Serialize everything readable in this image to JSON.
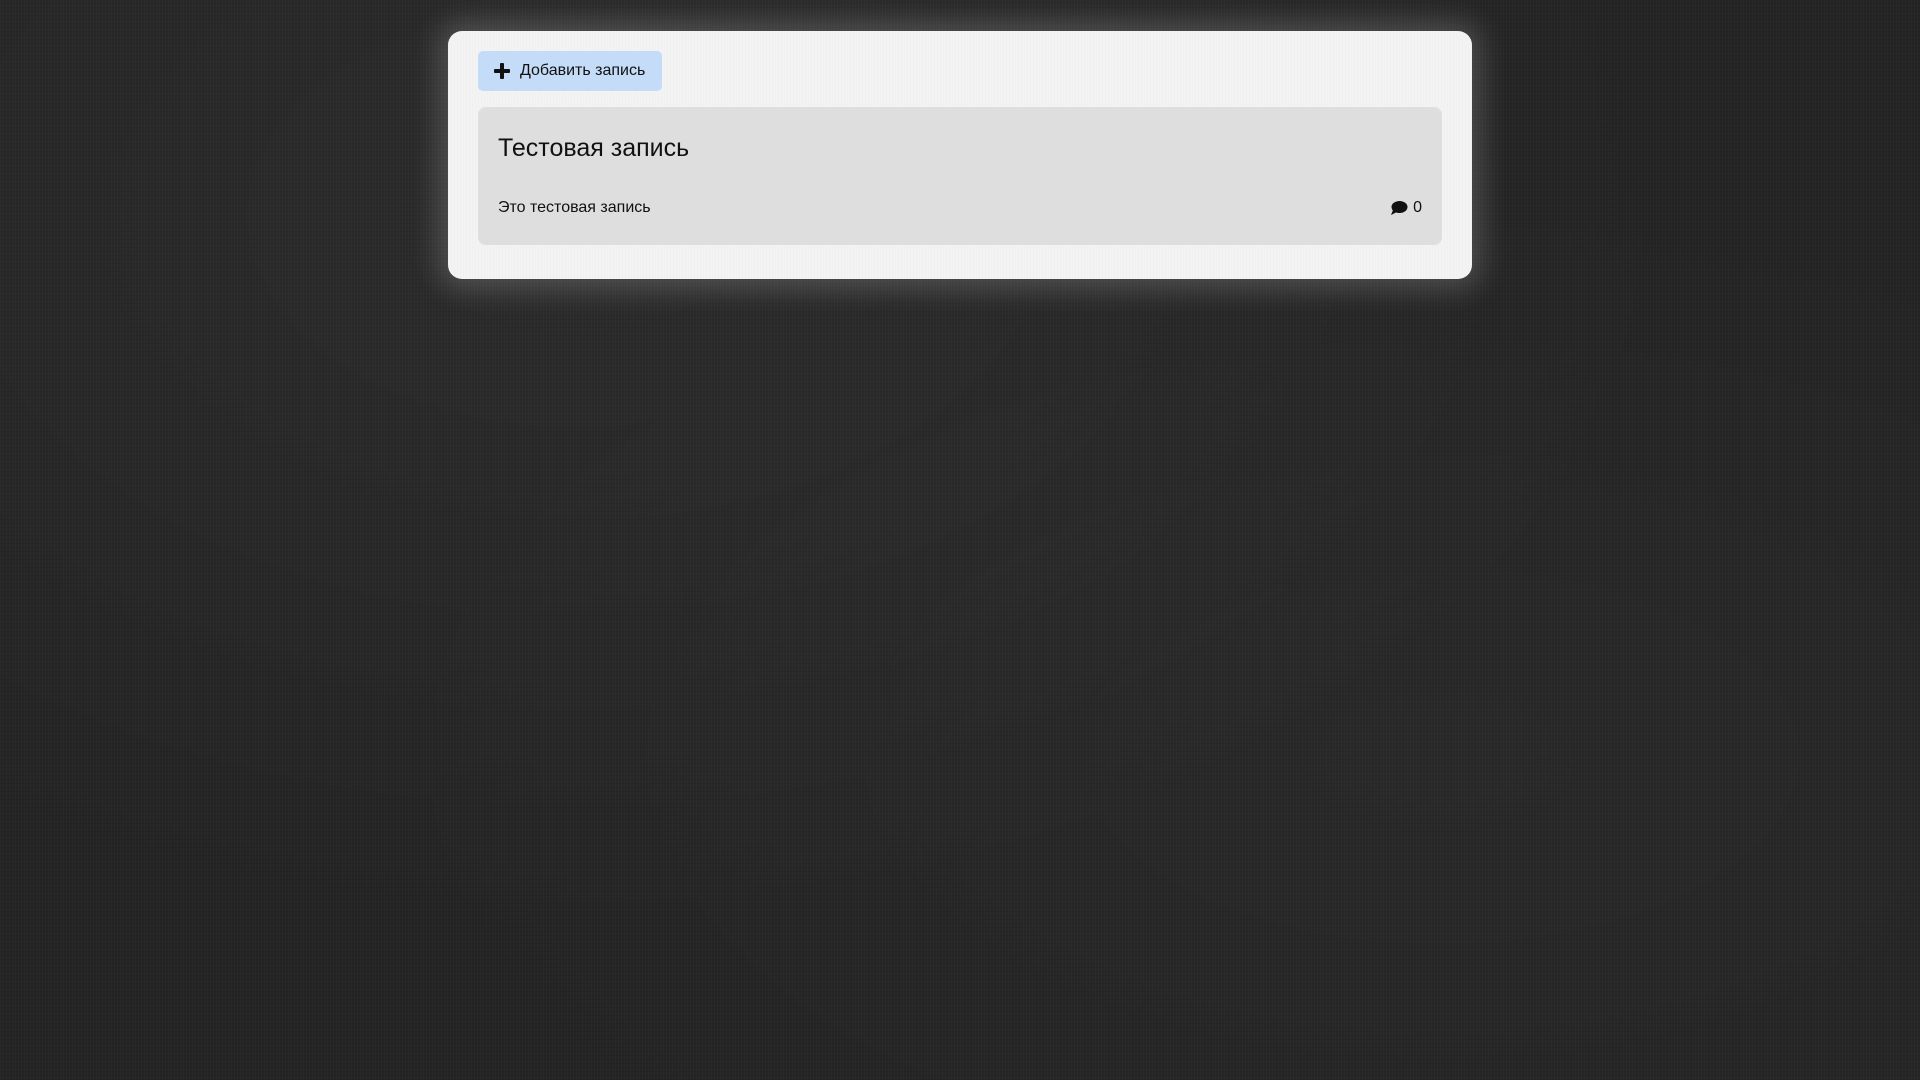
{
  "toolbar": {
    "add_label": "Добавить запись",
    "add_icon": "plus-icon",
    "add_button_color": "#c4dcf7"
  },
  "posts": [
    {
      "title": "Тестовая запись",
      "text": "Это тестовая запись",
      "comments_icon": "comment-icon",
      "comments_count": "0"
    }
  ]
}
